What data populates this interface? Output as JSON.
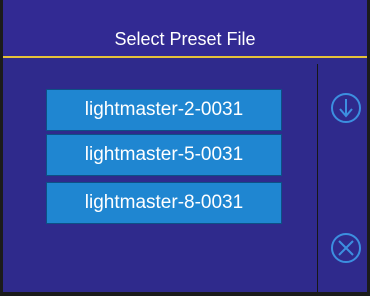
{
  "header": {
    "title": "Select Preset File"
  },
  "presets": [
    {
      "label": "lightmaster-2-0031"
    },
    {
      "label": "lightmaster-5-0031"
    },
    {
      "label": "lightmaster-8-0031"
    }
  ],
  "side_panel": {
    "icons": [
      "arrow-down-circle-icon",
      "close-circle-icon"
    ]
  },
  "colors": {
    "background": "#2f2a8c",
    "accent_line": "#e6c23a",
    "button_fill": "#1f86d1",
    "button_border": "#0d4f86",
    "icon_stroke": "#3c8fe0",
    "text": "#ffffff"
  }
}
